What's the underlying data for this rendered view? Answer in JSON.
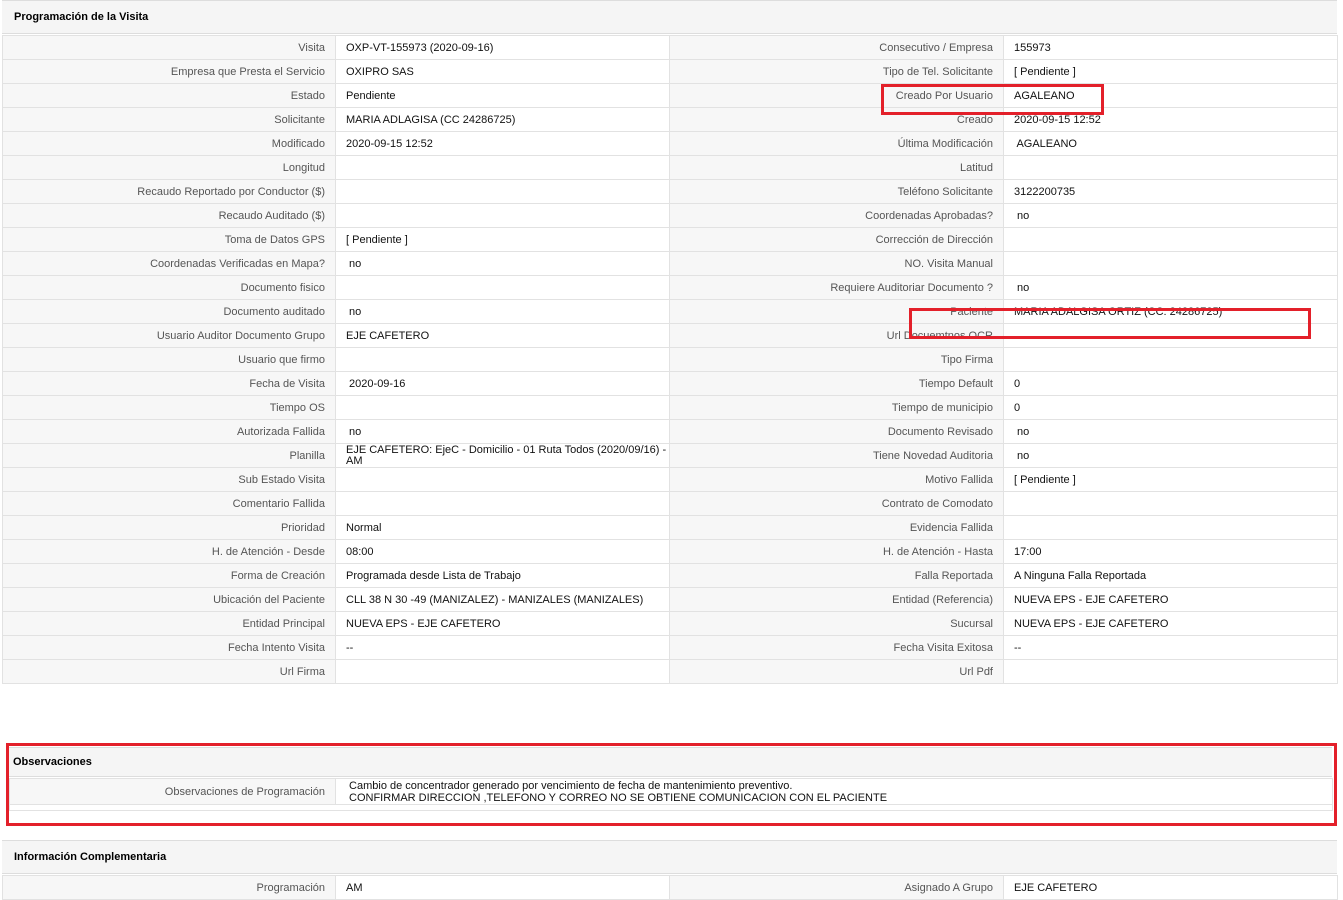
{
  "sections": {
    "programacion_title": "Programación de la Visita",
    "observaciones_title": "Observaciones",
    "info_title": "Información Complementaria"
  },
  "rows": [
    {
      "l1": "Visita",
      "v1": "OXP-VT-155973 (2020-09-16)",
      "l2": "Consecutivo / Empresa",
      "v2": "155973"
    },
    {
      "l1": "Empresa que Presta el Servicio",
      "v1": "OXIPRO SAS",
      "l2": "Tipo de Tel. Solicitante",
      "v2": "[ Pendiente ]"
    },
    {
      "l1": "Estado",
      "v1": "Pendiente",
      "l2": "Creado Por Usuario",
      "v2": "AGALEANO"
    },
    {
      "l1": "Solicitante",
      "v1": "MARIA ADLAGISA (CC 24286725)",
      "l2": "Creado",
      "v2": "2020-09-15 12:52"
    },
    {
      "l1": "Modificado",
      "v1": "2020-09-15 12:52",
      "l2": "Última Modificación",
      "v2": " AGALEANO"
    },
    {
      "l1": "Longitud",
      "v1": "",
      "l2": "Latitud",
      "v2": ""
    },
    {
      "l1": "Recaudo Reportado por Conductor ($)",
      "v1": "",
      "l2": "Teléfono Solicitante",
      "v2": "3122200735"
    },
    {
      "l1": "Recaudo Auditado ($)",
      "v1": "",
      "l2": "Coordenadas Aprobadas?",
      "v2": " no"
    },
    {
      "l1": "Toma de Datos GPS",
      "v1": "[ Pendiente ]",
      "l2": "Corrección de Dirección",
      "v2": ""
    },
    {
      "l1": "Coordenadas Verificadas en Mapa?",
      "v1": " no",
      "l2": "NO. Visita Manual",
      "v2": ""
    },
    {
      "l1": "Documento fisico",
      "v1": "",
      "l2": "Requiere Auditoriar Documento ?",
      "v2": " no"
    },
    {
      "l1": "Documento auditado",
      "v1": " no",
      "l2": "Paciente",
      "v2": "MARIA ADALGISA ORTIZ (CC: 24286725)"
    },
    {
      "l1": "Usuario Auditor Documento Grupo",
      "v1": "EJE CAFETERO",
      "l2": "Url Docuemtnos OCR",
      "v2": ""
    },
    {
      "l1": "Usuario que firmo",
      "v1": "",
      "l2": "Tipo Firma",
      "v2": ""
    },
    {
      "l1": "Fecha de Visita",
      "v1": " 2020-09-16",
      "l2": "Tiempo Default",
      "v2": "0"
    },
    {
      "l1": "Tiempo OS",
      "v1": "",
      "l2": "Tiempo de municipio",
      "v2": "0"
    },
    {
      "l1": "Autorizada Fallida",
      "v1": " no",
      "l2": "Documento Revisado",
      "v2": " no"
    },
    {
      "l1": "Planilla",
      "v1": "EJE CAFETERO: EjeC - Domicilio - 01 Ruta Todos (2020/09/16) - AM",
      "l2": "Tiene Novedad Auditoria",
      "v2": " no"
    },
    {
      "l1": "Sub Estado Visita",
      "v1": "",
      "l2": "Motivo Fallida",
      "v2": "[ Pendiente ]"
    },
    {
      "l1": "Comentario Fallida",
      "v1": "",
      "l2": "Contrato de Comodato",
      "v2": ""
    },
    {
      "l1": "Prioridad",
      "v1": "Normal",
      "l2": "Evidencia Fallida",
      "v2": ""
    },
    {
      "l1": "H. de Atención - Desde",
      "v1": "08:00",
      "l2": "H. de Atención - Hasta",
      "v2": "17:00"
    },
    {
      "l1": "Forma de Creación",
      "v1": "Programada desde Lista de Trabajo",
      "l2": "Falla Reportada",
      "v2": "A Ninguna Falla Reportada"
    },
    {
      "l1": "Ubicación del Paciente",
      "v1": "CLL 38 N 30 -49 (MANIZALEZ) - MANIZALES (MANIZALES)",
      "l2": "Entidad (Referencia)",
      "v2": "NUEVA EPS - EJE CAFETERO"
    },
    {
      "l1": "Entidad Principal",
      "v1": "NUEVA EPS - EJE CAFETERO",
      "l2": "Sucursal",
      "v2": "NUEVA EPS - EJE CAFETERO"
    },
    {
      "l1": "Fecha Intento Visita",
      "v1": "--",
      "l2": "Fecha Visita Exitosa",
      "v2": "--"
    },
    {
      "l1": "Url Firma",
      "v1": "",
      "l2": "Url Pdf",
      "v2": ""
    }
  ],
  "observaciones": {
    "label": "Observaciones de Programación",
    "line1": " Cambio de concentrador generado por vencimiento de fecha de mantenimiento preventivo.",
    "line2": "CONFIRMAR DIRECCION ,TELEFONO Y CORREO NO SE OBTIENE COMUNICACION CON EL PACIENTE"
  },
  "info_rows": [
    {
      "l1": "Programación",
      "v1": "AM",
      "l2": "Asignado A Grupo",
      "v2": "EJE CAFETERO"
    }
  ],
  "colors": {
    "highlight": "#e3202a",
    "label_bg": "#f7f7f7",
    "header_bg": "#f5f5f5"
  }
}
